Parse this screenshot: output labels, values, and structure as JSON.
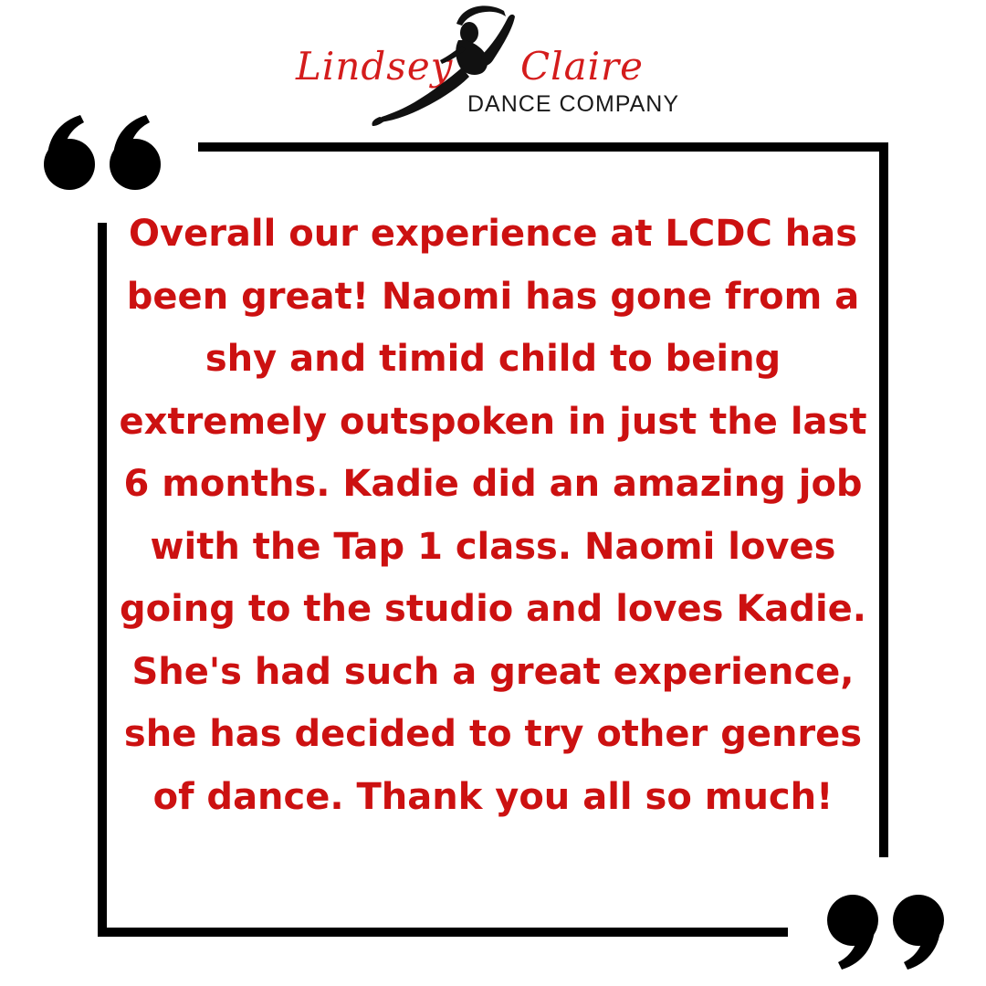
{
  "brand": {
    "script_left": "Lindsey",
    "script_right": "Claire",
    "subtitle": "DANCE COMPANY",
    "logo_icon": "dancer-silhouette-icon",
    "script_color": "#d41c1c",
    "subtitle_color": "#1a1a1a"
  },
  "testimonial": {
    "text": "Overall our experience at LCDC has been great! Naomi has gone from a shy and timid child to being extremely outspoken in just the last 6 months. Kadie did an amazing job with the Tap 1 class. Naomi loves going to the studio and loves Kadie. She's had such a great experience, she has decided to try other genres of dance. Thank you all so much!",
    "color": "#cc1111"
  },
  "decor": {
    "open_quote_icon": "open-quote-icon",
    "close_quote_icon": "close-quote-icon",
    "frame_color": "#000000"
  }
}
